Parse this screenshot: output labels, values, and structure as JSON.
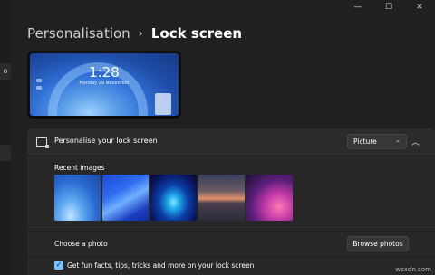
{
  "window": {
    "minimize_glyph": "—",
    "maximize_glyph": "☐",
    "close_glyph": "✕"
  },
  "sidebar": {
    "item_glyph": "o"
  },
  "breadcrumb": {
    "parent": "Personalisation",
    "separator": "›",
    "current": "Lock screen"
  },
  "preview": {
    "time": "1:28",
    "date": "Monday 29 November"
  },
  "lock_screen": {
    "label": "Personalise your lock screen",
    "dropdown_value": "Picture",
    "dropdown_chevron": "⌄",
    "collapse_glyph": "︿",
    "recent_images_label": "Recent images",
    "thumbnails": [
      "bloom-blue",
      "blue-ribbon",
      "glow-swirl",
      "sunset-lake",
      "pink-ribbon"
    ],
    "choose_photo_label": "Choose a photo",
    "browse_button": "Browse photos",
    "fun_facts_checked": true,
    "fun_facts_check_glyph": "✓",
    "fun_facts_label": "Get fun facts, tips, tricks and more on your lock screen"
  },
  "watermark": "wsxdn.com"
}
